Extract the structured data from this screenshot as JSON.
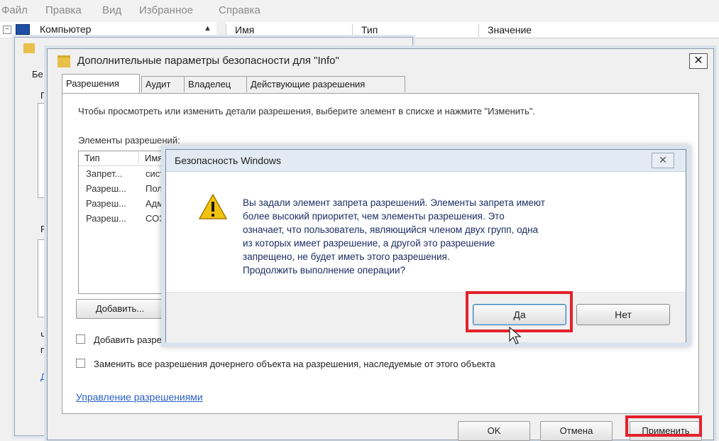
{
  "menubar": {
    "items": [
      "Файл",
      "Правка",
      "Вид",
      "Избранное",
      "Справка"
    ]
  },
  "registry": {
    "tree_root": "Компьютер",
    "columns": [
      "Имя",
      "Тип",
      "Значение"
    ]
  },
  "props_dialog": {
    "tab_fragment": "Бе",
    "left_fragments": [
      "Г",
      "Р",
      "Ч",
      "п",
      "Д"
    ]
  },
  "adv_dialog": {
    "title": "Дополнительные параметры безопасности  для \"Info\"",
    "close_glyph": "✕",
    "tabs": [
      "Разрешения",
      "Аудит",
      "Владелец",
      "Действующие разрешения"
    ],
    "instruction": "Чтобы просмотреть или изменить детали разрешения, выберите элемент в списке и нажмите \"Изменить\".",
    "perm_label": "Элементы разрешений:",
    "list_headers": [
      "Тип",
      "Имя"
    ],
    "rows": [
      {
        "type": "Запрет...",
        "name": "сист"
      },
      {
        "type": "Разреш...",
        "name": "Пол"
      },
      {
        "type": "Разреш...",
        "name": "Адм"
      },
      {
        "type": "Разреш...",
        "name": "СОЗ"
      }
    ],
    "add_button": "Добавить...",
    "checkbox_inherit": "Добавить разрешения, наследуемые от родительских объектов",
    "checkbox_replace": "Заменить все разрешения дочернего объекта на разрешения, наследуемые от этого объекта",
    "manage_link": "Управление разрешениями",
    "ok": "OK",
    "cancel": "Отмена",
    "apply": "Применить"
  },
  "message_box": {
    "title": "Безопасность Windows",
    "close_glyph": "✕",
    "lines": [
      "Вы задали элемент запрета разрешений. Элементы запрета имеют",
      "более высокий приоритет, чем элементы разрешения. Это",
      "означает, что пользователь, являющийся членом двух групп, одна",
      "из которых имеет разрешение, а другой это разрешение",
      "запрещено, не будет иметь этого разрешения.",
      "Продолжить выполнение операции?"
    ],
    "yes": "Да",
    "no": "Нет"
  },
  "colors": {
    "highlight": "#e3222b",
    "link": "#2c5fc5",
    "warning": "#f2c20f"
  }
}
